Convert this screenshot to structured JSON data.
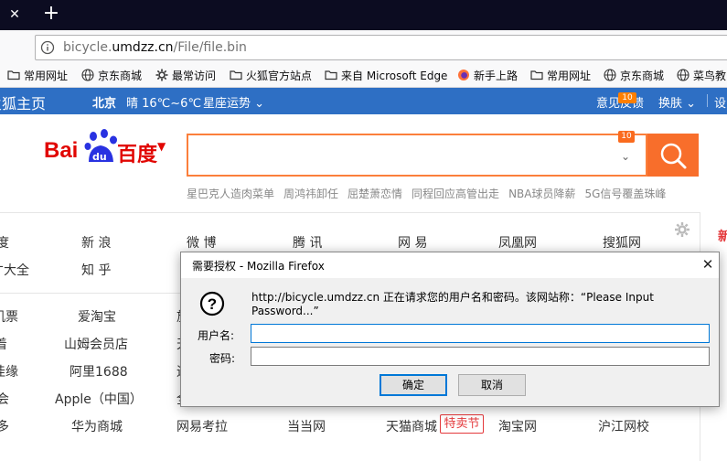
{
  "browser": {
    "url_prefix": "bicycle.",
    "url_domain": "umdzz.cn",
    "url_path": "/File/file.bin"
  },
  "bookmarks": [
    {
      "label": "常用网址",
      "icon": "folder-icon"
    },
    {
      "label": "京东商城",
      "icon": "globe-icon"
    },
    {
      "label": "最常访问",
      "icon": "gear-icon"
    },
    {
      "label": "火狐官方站点",
      "icon": "folder-icon"
    },
    {
      "label": "来自 Microsoft Edge",
      "icon": "folder-icon"
    },
    {
      "label": "新手上路",
      "icon": "firefox-icon"
    },
    {
      "label": "常用网址",
      "icon": "folder-icon"
    },
    {
      "label": "京东商城",
      "icon": "globe-icon"
    },
    {
      "label": "菜鸟教",
      "icon": "globe-icon"
    }
  ],
  "header": {
    "home": "火狐主页",
    "city": "北京",
    "weather": "晴 16℃~6℃",
    "horoscope": "星座运势",
    "feedback": "意见反馈",
    "feedback_badge": "10",
    "skin": "换肤",
    "settings": "设"
  },
  "baidu": {
    "logo_bai": "Bai",
    "logo_du": "du",
    "logo_cn": "百度",
    "search_badge": "10",
    "hotwords": [
      "星巴克人造肉菜单",
      "周鸿祎卸任",
      "屈楚萧恋情",
      "同程回应高管出走",
      "NBA球员降薪",
      "5G信号覆盖珠峰"
    ]
  },
  "links": {
    "row1": [
      "度",
      "新 浪",
      "微 博",
      "腾 讯",
      "网 易",
      "凤凰网",
      "搜狐网"
    ],
    "row2": [
      "才大全",
      "知 乎"
    ],
    "row3": [
      "机票",
      "爱淘宝",
      "旅"
    ],
    "row4": [
      "着",
      "山姆会员店",
      "天"
    ],
    "row5": [
      "佳缘",
      "阿里1688",
      "途"
    ],
    "row6": [
      "会",
      "Apple（中国）",
      "全"
    ],
    "row7": [
      "多",
      "华为商城",
      "网易考拉",
      "当当网",
      "天猫商城",
      "淘宝网",
      "沪江网校"
    ],
    "hot_tag": "特卖节",
    "right_red": "新"
  },
  "dialog": {
    "title": "需要授权 - Mozilla Firefox",
    "message": "http://bicycle.umdzz.cn 正在请求您的用户名和密码。该网站称：“Please Input Password...”",
    "user_label": "用户名:",
    "pass_label": "密码:",
    "user_value": "",
    "pass_value": "",
    "ok": "确定",
    "cancel": "取消"
  }
}
